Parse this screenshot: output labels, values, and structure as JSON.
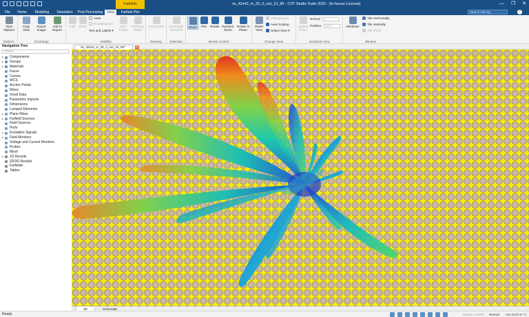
{
  "app": {
    "title": "ris_42x42_in_30_0_out_10_80 - CST Studio Suite 2025 - [In-house License]",
    "context_tab": "Farfields"
  },
  "tabs": [
    "File",
    "Home",
    "Modeling",
    "Simulation",
    "Post-Processing",
    "View",
    "Farfield Plot"
  ],
  "active_tab": "View",
  "search_placeholder": "Search (Alt+Q)",
  "help_label": "?",
  "window_buttons": [
    "—",
    "❐",
    "✕"
  ],
  "ribbon": {
    "options": {
      "label": "Options",
      "view_options": "View Options"
    },
    "exchange": {
      "label": "Exchange",
      "copy_view": "Copy View",
      "export_image": "Export Image",
      "add_to_report": "Add to Report"
    },
    "visibility": {
      "label": "Visibility",
      "hide": "Hide",
      "show": "Show",
      "axes": "Axes",
      "bounding_box": "Bounding Box",
      "text_and_labels": "Text and Labels",
      "wire_frame": "Wire Frame",
      "working_plane": "Working Plane"
    },
    "drawing": {
      "label": "Drawing",
      "dimension": "Dimension"
    },
    "selection": {
      "label": "Selection",
      "rectangle_selection": "Rectangle Selection"
    },
    "mouse_control": {
      "label": "Mouse Control",
      "zoom": "Zoom",
      "pan": "Pan",
      "rotate": "Rotate",
      "dynamic_zoom": "Dynamic Zoom",
      "rotate_in_plane": "Rotate in Plane"
    },
    "change_view": {
      "label": "Change View",
      "reset_view": "Reset View",
      "orthographic": "Orthographic",
      "axes_scaling": "Axes Scaling",
      "select_view": "Select View"
    },
    "sectional_view": {
      "label": "Sectional View",
      "cutting_plane": "Cutting Plane",
      "normal": "Normal",
      "position": "Position",
      "normal_value": "X",
      "position_value": "147.5"
    },
    "window": {
      "label": "Window",
      "windows": "Windows",
      "tile_horizontally": "Tile Horizontally",
      "tile_vertically": "Tile Vertically",
      "tile_three": "Tile Three"
    }
  },
  "navigation": {
    "title": "Navigation Tree",
    "filter_placeholder": "<Filter>",
    "items": [
      {
        "label": "Components",
        "color": "#6d8fb3",
        "expandable": true
      },
      {
        "label": "Groups",
        "color": "#6d8fb3",
        "expandable": true
      },
      {
        "label": "Materials",
        "color": "#6d8fb3",
        "expandable": true
      },
      {
        "label": "Faces",
        "color": "#7aa0c7",
        "expandable": false
      },
      {
        "label": "Curves",
        "color": "#7aa0c7",
        "expandable": false
      },
      {
        "label": "WCS",
        "color": "#7aa0c7",
        "expandable": false
      },
      {
        "label": "Anchor Points",
        "color": "#7aa0c7",
        "expandable": false
      },
      {
        "label": "Wires",
        "color": "#7aa0c7",
        "expandable": false
      },
      {
        "label": "Voxel Data",
        "color": "#7aa0c7",
        "expandable": false
      },
      {
        "label": "Parametric Imports",
        "color": "#7aa0c7",
        "expandable": false
      },
      {
        "label": "Dimensions",
        "color": "#7aa0c7",
        "expandable": false
      },
      {
        "label": "Lumped Elements",
        "color": "#7aa0c7",
        "expandable": false
      },
      {
        "label": "Plane Wave",
        "color": "#7aa0c7",
        "expandable": true
      },
      {
        "label": "Farfield Sources",
        "color": "#7aa0c7",
        "expandable": true
      },
      {
        "label": "Field Sources",
        "color": "#7aa0c7",
        "expandable": false
      },
      {
        "label": "Ports",
        "color": "#7aa0c7",
        "expandable": false
      },
      {
        "label": "Excitation Signals",
        "color": "#7aa0c7",
        "expandable": true
      },
      {
        "label": "Field Monitors",
        "color": "#7aa0c7",
        "expandable": true
      },
      {
        "label": "Voltage and Current Monitors",
        "color": "#7aa0c7",
        "expandable": false
      },
      {
        "label": "Probes",
        "color": "#7aa0c7",
        "expandable": false
      },
      {
        "label": "Mesh",
        "color": "#7aa0c7",
        "expandable": false
      },
      {
        "label": "1D Results",
        "color": "#8c8c8c",
        "expandable": true
      },
      {
        "label": "2D/3D Results",
        "color": "#8c8c8c",
        "expandable": false
      },
      {
        "label": "Farfields",
        "color": "#8c8c8c",
        "expandable": false
      },
      {
        "label": "Tables",
        "color": "#8c8c8c",
        "expandable": false
      }
    ]
  },
  "document": {
    "tab_label": "ris_42x42_in_30_0_out_10_80*",
    "close_label": "×"
  },
  "sheets": [
    "3D",
    "Schematic"
  ],
  "active_sheet": "3D",
  "status": {
    "ready": "Ready",
    "raster": "Raster=10.000",
    "mode": "Normal",
    "units": "mm  GHz  ns  °C"
  },
  "colors": {
    "title_bar": "#1a4f86",
    "context_tab": "#f3c200",
    "viewport_background": "#f5ec14",
    "unit_cell_fill": "#c8b6a6"
  }
}
